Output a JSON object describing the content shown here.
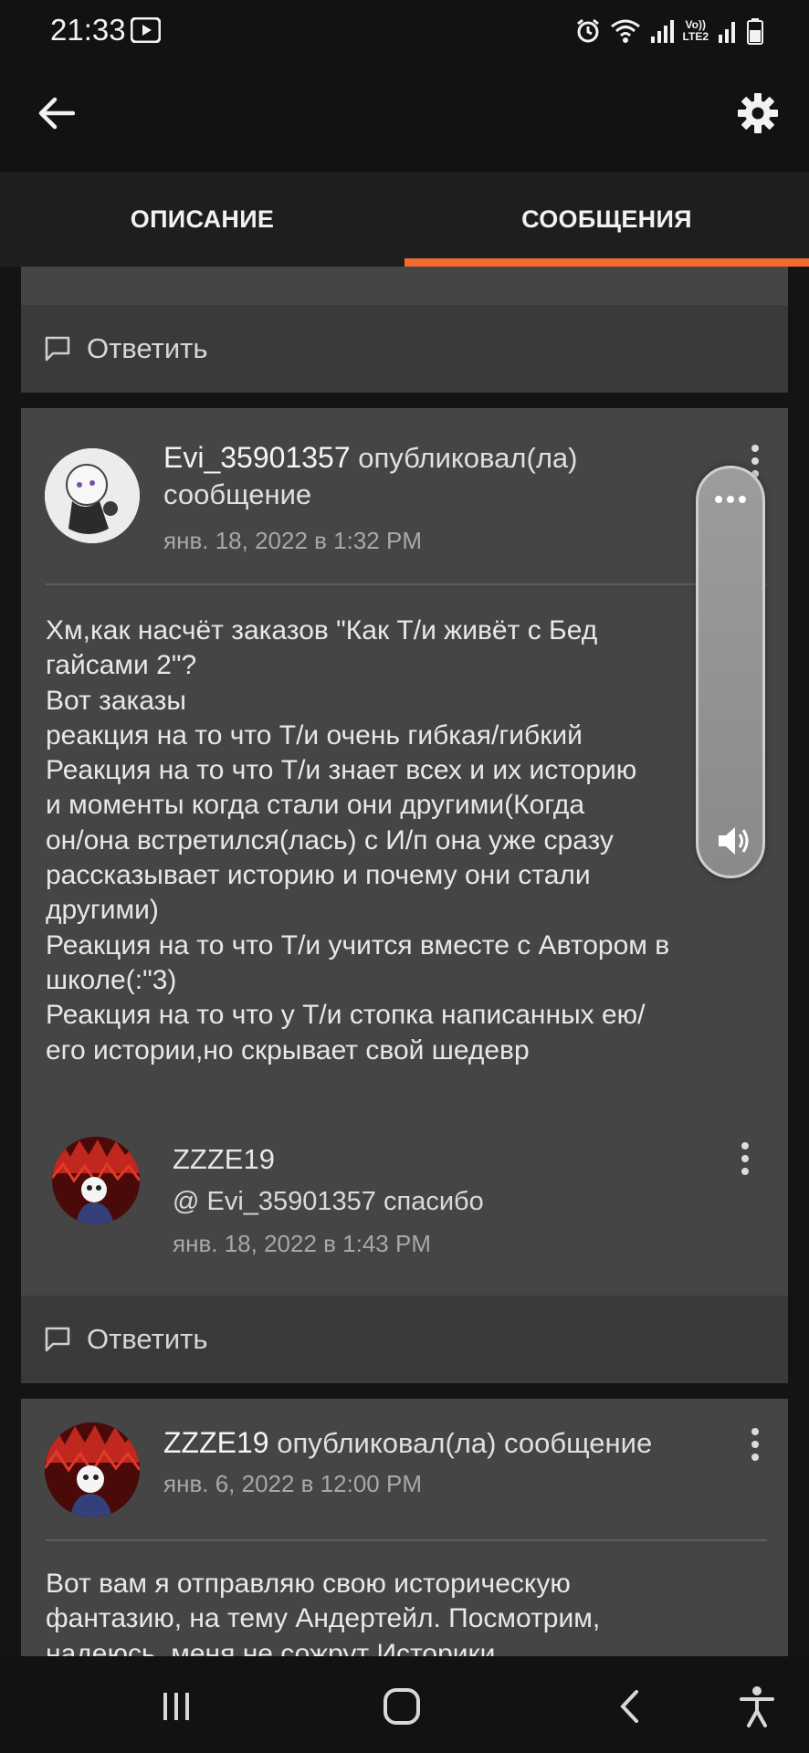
{
  "status_bar": {
    "time": "21:33",
    "lte_top": "Vo))",
    "lte_bottom": "LTE2"
  },
  "tabs": [
    {
      "label": "ОПИСАНИЕ",
      "active": false
    },
    {
      "label": "СООБЩЕНИЯ",
      "active": true
    }
  ],
  "accent_color": "#f26a32",
  "reply_label": "Ответить",
  "post1": {
    "author": "Evi_35901357",
    "action_part1": "опубликовал(ла)",
    "action_part2": "сообщение",
    "date": "янв. 18, 2022 в 1:32 PM",
    "body_lines": [
      "Хм,как насчёт заказов \"Как Т/и живёт с Бед",
      "гайсами 2\"?",
      "Вот заказы",
      "реакция на то что Т/и очень гибкая/гибкий",
      "Реакция на то что Т/и знает всех и их историю",
      "и моменты когда стали они другими(Когда",
      "он/она встретился(лась) с И/п она уже сразу",
      "рассказывает историю и почему они стали",
      "другими)",
      "Реакция на то что Т/и учится вместе с Автором в",
      "школе(:\"3)",
      "Реакция на то что у Т/и стопка написанных ею/",
      "его истории,но скрывает свой шедевр"
    ],
    "reply": {
      "author": "ZZZE19",
      "text": "@ Evi_35901357 спасибо",
      "date": "янв. 18, 2022 в 1:43 PM"
    }
  },
  "post2": {
    "author": "ZZZE19",
    "action": "опубликовал(ла) сообщение",
    "date": "янв. 6, 2022 в 12:00 PM",
    "body_lines": [
      "Вот вам я отправляю свою историческую",
      "фантазию, на тему Андертейл. Посмотрим,",
      "надеюсь, меня не сожрут Историки..."
    ]
  },
  "icons": {
    "back": "arrow-left-icon",
    "settings": "gear-icon",
    "reply": "comment-icon",
    "more": "kebab-menu-icon",
    "volume": "speaker-icon",
    "nav_recent": "recent-apps-icon",
    "nav_home": "home-icon",
    "nav_back": "chevron-left-icon",
    "nav_accessibility": "accessibility-icon"
  }
}
